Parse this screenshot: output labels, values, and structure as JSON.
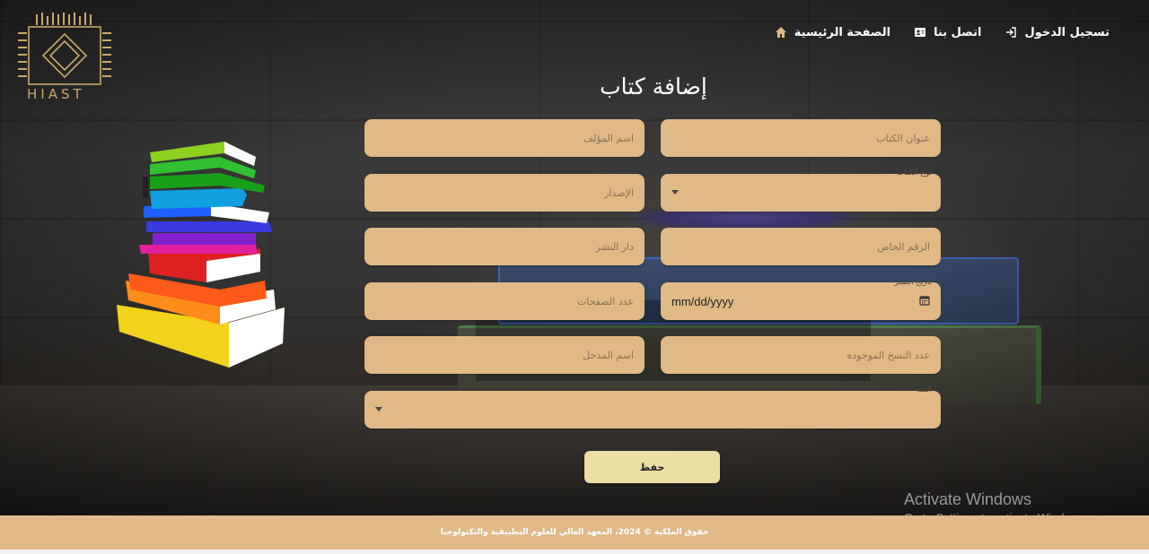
{
  "header": {
    "logo_text": "HIAST",
    "nav": [
      {
        "label": "تسجيل الدخول",
        "icon": "login-icon"
      },
      {
        "label": "اتصل بنا",
        "icon": "contact-card-icon"
      },
      {
        "label": "الصفحة الرئيسية",
        "icon": "home-icon"
      }
    ]
  },
  "page": {
    "title": "إضافة كتاب"
  },
  "form": {
    "book_title": "عنوان الكتاب",
    "author_name": "اسم المؤلف",
    "book_type_label": "نوع الكتاب",
    "edition": "الإصدار",
    "private_number": "الرقم الخاص",
    "publisher": "دار النشر",
    "publish_date_label": "تاريخ النشر",
    "publish_date_value": "mm/dd/yyyy",
    "pages_count": "عدد الصفحات",
    "copies_count": "عدد النسخ الموجوده",
    "entry_name": "اسم المدخل",
    "category_label": "الفئة",
    "save_label": "حفظ"
  },
  "footer": {
    "text": "حقوق الملكية © 2024، المعهد العالي للعلوم التطبيقية والتكنولوجيا"
  },
  "watermark": {
    "line1": "Activate Windows",
    "line2": "Go to Settings to activate Windows."
  },
  "colors": {
    "field_bg": "#e0b987",
    "button_bg": "#ecdfa4",
    "footer_bg": "#e0b987",
    "logo_gold": "#c9a96a"
  }
}
